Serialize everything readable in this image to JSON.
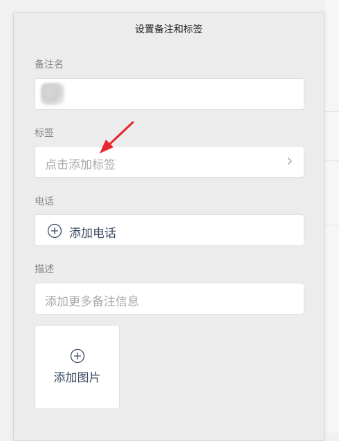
{
  "dialog": {
    "title": "设置备注和标签"
  },
  "remark": {
    "label": "备注名",
    "value": ""
  },
  "tags": {
    "label": "标签",
    "placeholder": "点击添加标签"
  },
  "phone": {
    "label": "电话",
    "add_label": "添加电话"
  },
  "description": {
    "label": "描述",
    "placeholder": "添加更多备注信息",
    "add_photo_label": "添加图片"
  },
  "icons": {
    "chevron": "chevron-right-icon",
    "plus": "plus-circle-icon",
    "annotation": "red-arrow"
  },
  "colors": {
    "accent_text": "#3a4a63",
    "annotation_arrow": "#e8262b"
  }
}
